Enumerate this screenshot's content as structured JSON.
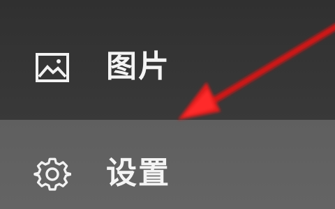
{
  "menu": {
    "items": [
      {
        "label": "图片",
        "icon": "image-icon"
      },
      {
        "label": "设置",
        "icon": "gear-icon"
      }
    ]
  },
  "annotation": {
    "arrow_color": "#e01a1a",
    "icon": "red-arrow-icon"
  }
}
